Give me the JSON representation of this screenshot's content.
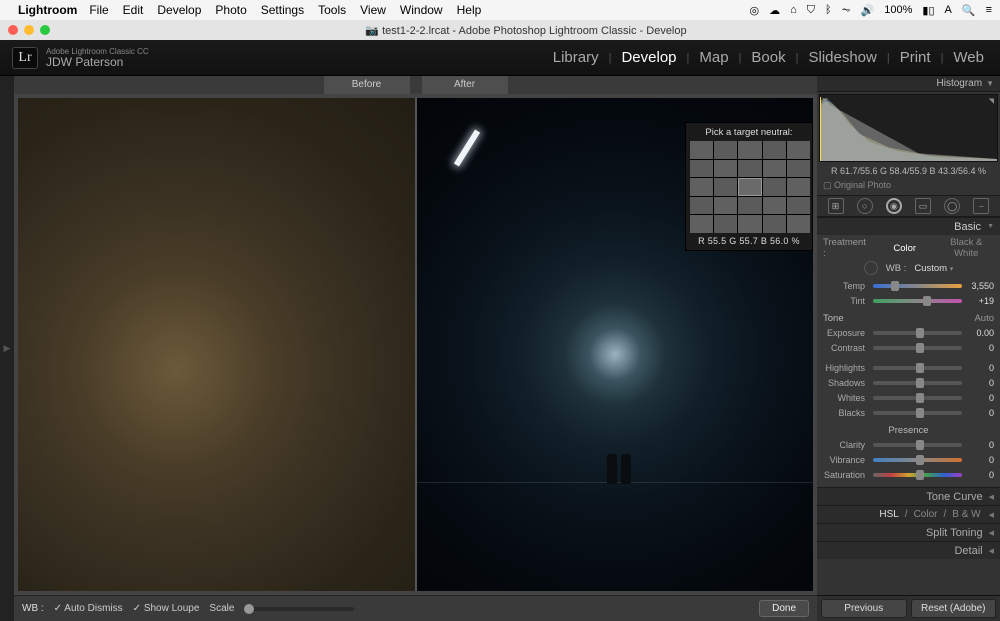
{
  "mac_menu": {
    "app": "Lightroom",
    "items": [
      "File",
      "Edit",
      "Develop",
      "Photo",
      "Settings",
      "Tools",
      "View",
      "Window",
      "Help"
    ],
    "battery": "100%"
  },
  "window": {
    "title": "test1-2-2.lrcat - Adobe Photoshop Lightroom Classic - Develop"
  },
  "lr": {
    "brand_line1": "Adobe Lightroom Classic CC",
    "brand_line2": "JDW Paterson",
    "modules": [
      "Library",
      "Develop",
      "Map",
      "Book",
      "Slideshow",
      "Print",
      "Web"
    ],
    "active_module": "Develop"
  },
  "viewer": {
    "before_label": "Before",
    "after_label": "After"
  },
  "loupe": {
    "title": "Pick a target neutral:",
    "readout": "R 55.5   G 55.7   B 56.0  %"
  },
  "center_bottom": {
    "wb_label": "WB :",
    "auto_dismiss": "Auto Dismiss",
    "show_loupe": "Show Loupe",
    "scale_label": "Scale",
    "done": "Done"
  },
  "histogram": {
    "title": "Histogram",
    "rgb": "R 61.7/55.6  G 58.4/55.9  B 43.3/56.4  %",
    "orig": "Original Photo"
  },
  "basic": {
    "title": "Basic",
    "treatment_label": "Treatment :",
    "color": "Color",
    "bw": "Black & White",
    "wb_label": "WB :",
    "wb_value": "Custom",
    "temp_label": "Temp",
    "temp_value": "3,550",
    "tint_label": "Tint",
    "tint_value": "+19",
    "tone_title": "Tone",
    "auto": "Auto",
    "exposure_label": "Exposure",
    "exposure_value": "0.00",
    "contrast_label": "Contrast",
    "contrast_value": "0",
    "highlights_label": "Highlights",
    "highlights_value": "0",
    "shadows_label": "Shadows",
    "shadows_value": "0",
    "whites_label": "Whites",
    "whites_value": "0",
    "blacks_label": "Blacks",
    "blacks_value": "0",
    "presence_title": "Presence",
    "clarity_label": "Clarity",
    "clarity_value": "0",
    "vibrance_label": "Vibrance",
    "vibrance_value": "0",
    "saturation_label": "Saturation",
    "saturation_value": "0"
  },
  "sections": {
    "tone_curve": "Tone Curve",
    "hsl_prefix": "HSL",
    "hsl_color": "Color",
    "hsl_bw": "B & W",
    "split_toning": "Split Toning",
    "detail": "Detail"
  },
  "panel_bottom": {
    "previous": "Previous",
    "reset": "Reset (Adobe)"
  }
}
